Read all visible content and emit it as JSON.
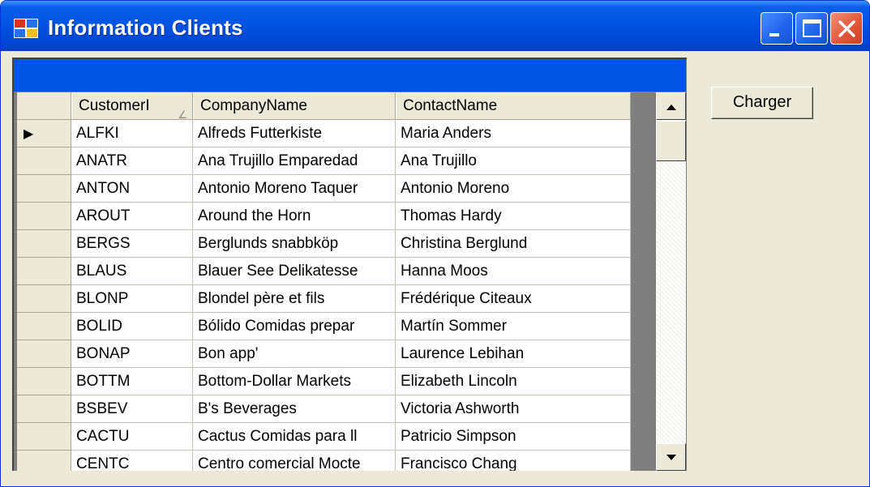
{
  "window": {
    "title": "Information Clients"
  },
  "toolbar": {
    "load_label": "Charger"
  },
  "grid": {
    "columns": [
      "CustomerI",
      "CompanyName",
      "ContactName"
    ],
    "sorted_column": "CustomerI",
    "current_row_indicator": "▶",
    "rows": [
      [
        "ALFKI",
        "Alfreds Futterkiste",
        "Maria Anders"
      ],
      [
        "ANATR",
        "Ana Trujillo Emparedad",
        "Ana Trujillo"
      ],
      [
        "ANTON",
        "Antonio Moreno Taquer",
        "Antonio Moreno"
      ],
      [
        "AROUT",
        "Around the Horn",
        "Thomas Hardy"
      ],
      [
        "BERGS",
        "Berglunds snabbköp",
        "Christina Berglund"
      ],
      [
        "BLAUS",
        "Blauer See Delikatesse",
        "Hanna Moos"
      ],
      [
        "BLONP",
        "Blondel père et fils",
        "Frédérique Citeaux"
      ],
      [
        "BOLID",
        "Bólido Comidas prepar",
        "Martín Sommer"
      ],
      [
        "BONAP",
        "Bon app'",
        "Laurence Lebihan"
      ],
      [
        "BOTTM",
        "Bottom-Dollar Markets",
        "Elizabeth Lincoln"
      ],
      [
        "BSBEV",
        "B's Beverages",
        "Victoria Ashworth"
      ],
      [
        "CACTU",
        "Cactus Comidas para ll",
        "Patricio Simpson"
      ],
      [
        "CENTC",
        "Centro comercial Mocte",
        "Francisco Chang"
      ]
    ]
  },
  "colors": {
    "titlebar": "#0054e3",
    "caption_bar": "#0054e3",
    "window_bg": "#ece9d8"
  }
}
